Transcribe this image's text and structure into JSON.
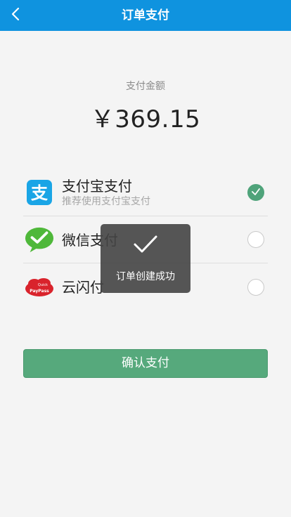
{
  "header": {
    "title": "订单支付",
    "bg_color": "#0f93df"
  },
  "amount": {
    "label": "支付金额",
    "value": "￥369.15"
  },
  "payment_methods": [
    {
      "name": "支付宝支付",
      "subtitle": "推荐使用支付宝支付",
      "icon": "alipay-icon",
      "selected": true
    },
    {
      "name": "微信支付",
      "subtitle": "",
      "icon": "wechat-pay-icon",
      "selected": false
    },
    {
      "name": "云闪付",
      "subtitle": "",
      "icon": "unionpay-quickpass-icon",
      "selected": false
    }
  ],
  "confirm_button": {
    "label": "确认支付",
    "color": "#56a97c"
  },
  "toast": {
    "icon": "checkmark-icon",
    "message": "订单创建成功"
  },
  "accent_colors": {
    "selected_radio": "#4fa37a"
  }
}
